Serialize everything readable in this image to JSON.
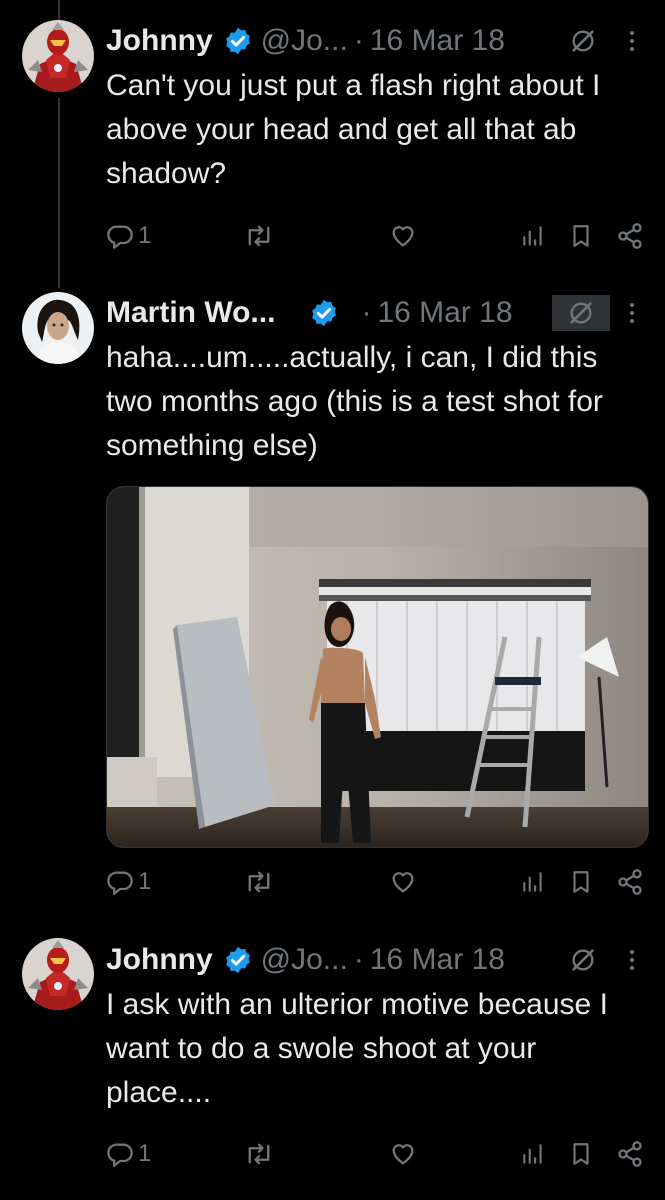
{
  "tweets": [
    {
      "name": "Johnny",
      "handle": "@Jo...",
      "separator": "·",
      "date": "16 Mar 18",
      "text": "Can't you just put a flash right about I above your head and get all that ab shadow?",
      "replies": "1"
    },
    {
      "name": "Martin Wo...",
      "handle": "",
      "separator": "·",
      "date": "16 Mar 18",
      "text": "haha....um.....actually, i can, I did this two months ago (this is a test shot for something else)",
      "replies": "1"
    },
    {
      "name": "Johnny",
      "handle": "@Jo...",
      "separator": "·",
      "date": "16 Mar 18",
      "text": "I ask with an ulterior motive because I want to do a swole shoot at your place....",
      "replies": "1"
    }
  ],
  "icons": {
    "verified": "verified-badge-icon",
    "grok": "grok-icon",
    "more": "more-options-icon",
    "reply": "reply-icon",
    "retweet": "retweet-icon",
    "like": "like-icon",
    "views": "views-icon",
    "bookmark": "bookmark-icon",
    "share": "share-icon"
  },
  "colors": {
    "background": "#000000",
    "text": "#e7e9ea",
    "secondary": "#71767b",
    "verified": "#1d9bf0",
    "thread_line": "#333639"
  }
}
